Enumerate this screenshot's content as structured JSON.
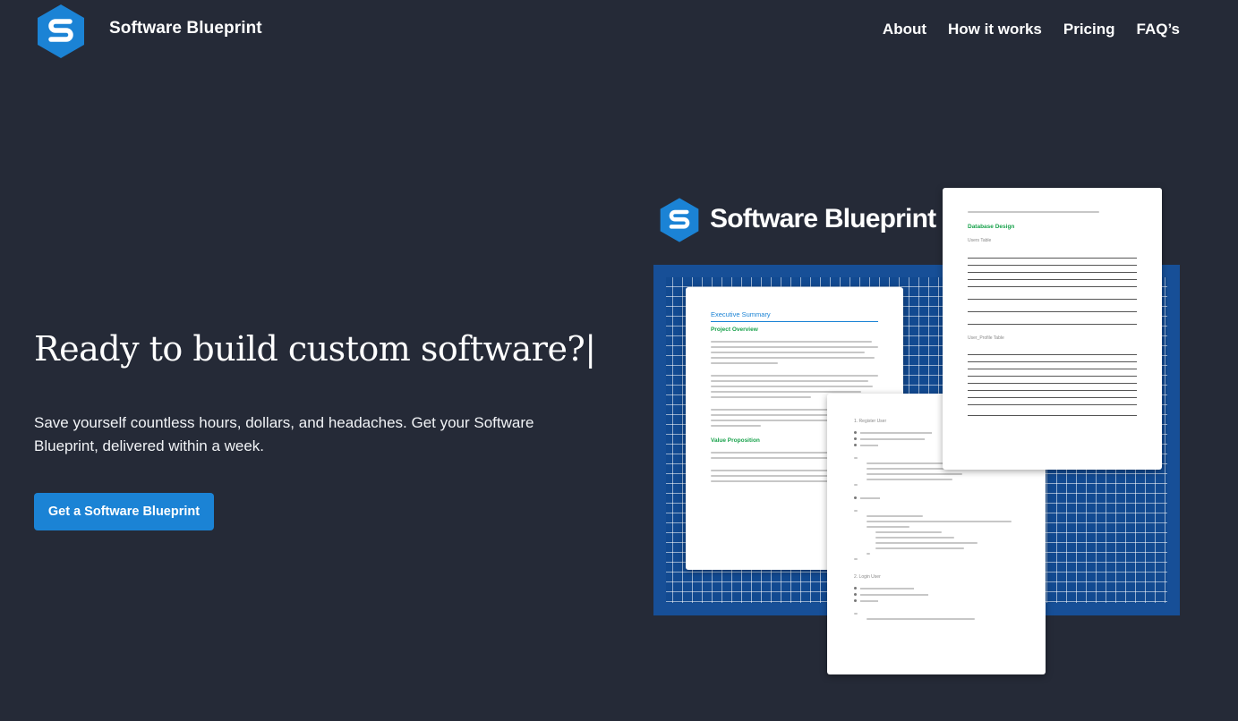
{
  "header": {
    "brand": "Software Blueprint",
    "nav": [
      "About",
      "How it works",
      "Pricing",
      "FAQ’s"
    ]
  },
  "hero": {
    "title": "Ready to build custom software?|",
    "subtitle": "Save yourself countless hours, dollars, and headaches. Get your Software Blueprint, delivered within a week.",
    "cta_label": "Get a Software Blueprint"
  },
  "illustration": {
    "brand": "Software Blueprint",
    "doc1": {
      "heading": "Executive Summary",
      "subheading": "Project Overview",
      "subheading2": "Value Proposition"
    },
    "doc3": {
      "heading": "Database Design",
      "table1_caption": "Users Table",
      "table2_caption": "User_Profile Table"
    },
    "doc2": {
      "item1": "1. Register User",
      "item2": "2. Login User"
    }
  },
  "colors": {
    "background": "#252a37",
    "accent": "#1b83d5",
    "blueprint": "#124a91",
    "green_heading": "#19a24c"
  },
  "icons": [
    "software-blueprint-logo-icon"
  ]
}
